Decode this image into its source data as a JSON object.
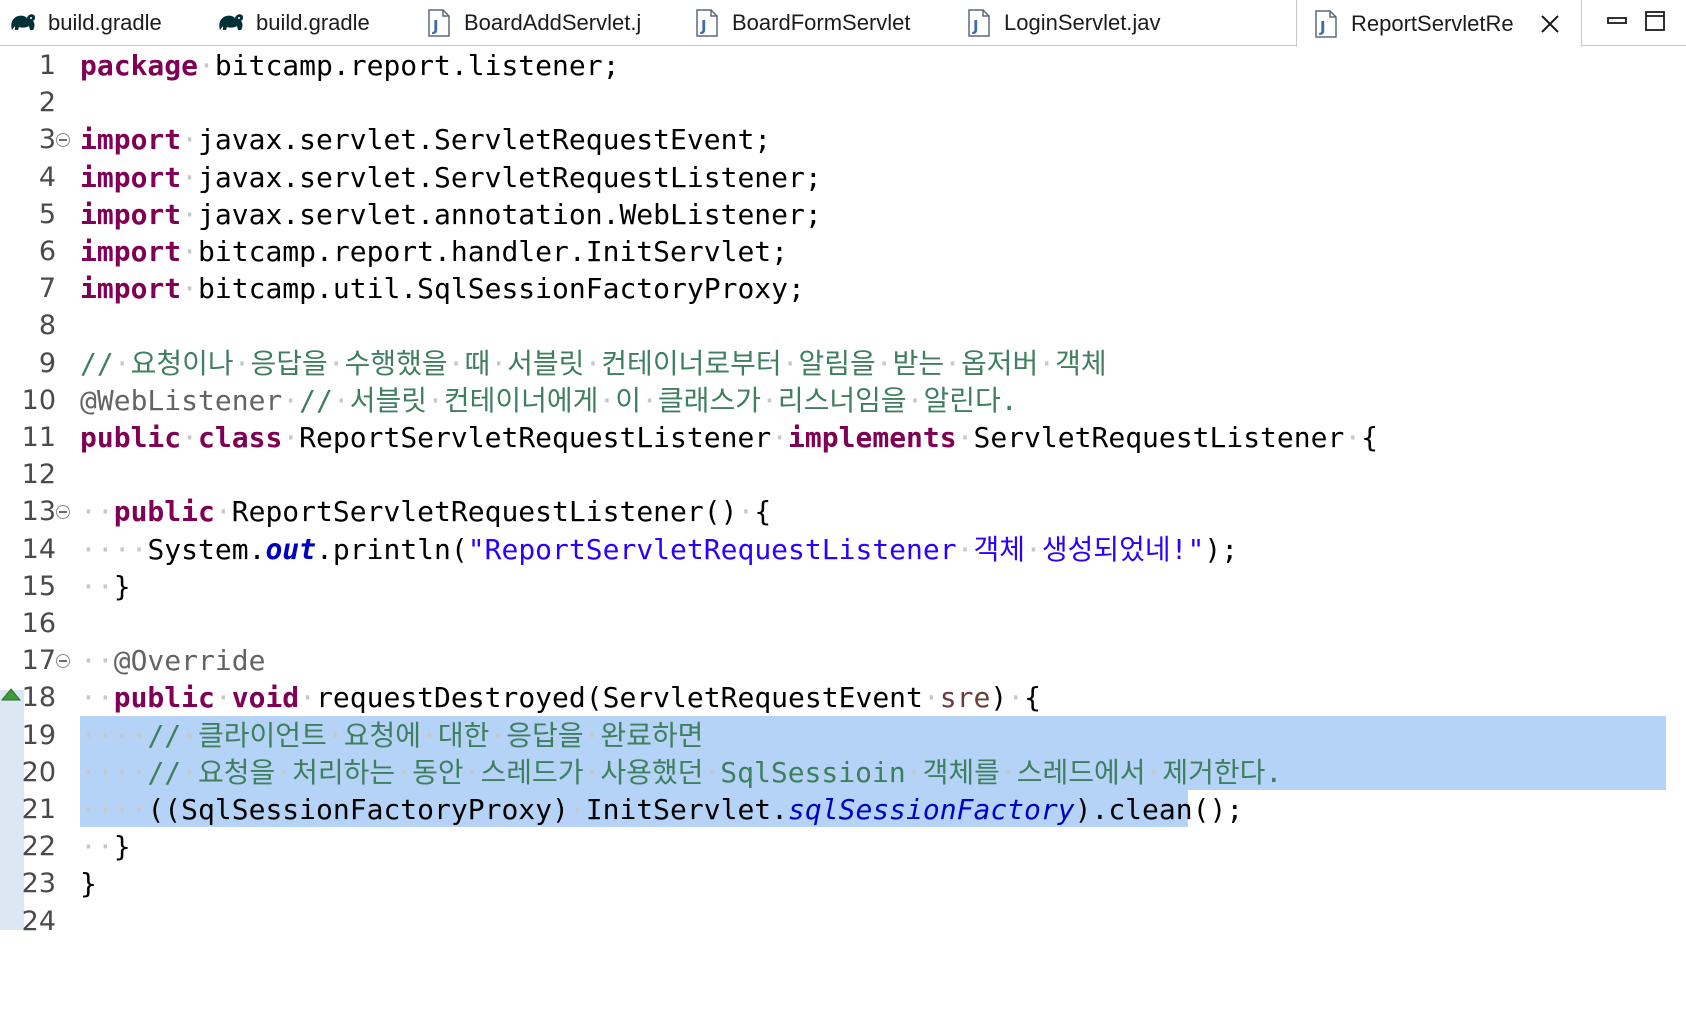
{
  "tabs": [
    {
      "label": "build.gradle",
      "icon": "gradle-elephant-icon"
    },
    {
      "label": "build.gradle",
      "icon": "gradle-elephant-icon"
    },
    {
      "label": "BoardAddServlet.j",
      "icon": "java-file-icon"
    },
    {
      "label": "BoardFormServlet",
      "icon": "java-file-icon"
    },
    {
      "label": "LoginServlet.jav",
      "icon": "java-file-icon"
    },
    {
      "label": "ReportServletRe",
      "icon": "java-file-icon",
      "active": true
    }
  ],
  "window_controls": {
    "minimize": "minimize-icon",
    "maximize": "maximize-icon"
  },
  "editor": {
    "colors": {
      "keyword": "#7f0055",
      "comment": "#3f7f5f",
      "annotation": "#646464",
      "string": "#2a00ff",
      "static_field": "#0000c0",
      "parameter": "#6a3e3e",
      "selection": "#b5d3f6",
      "whitespace_marker": "#c8c8c8"
    },
    "lines": [
      {
        "n": "1",
        "code": "package·bitcamp.report.listener;"
      },
      {
        "n": "2",
        "code": ""
      },
      {
        "n": "3",
        "code": "import·javax.servlet.ServletRequestEvent;",
        "fold": true
      },
      {
        "n": "4",
        "code": "import·javax.servlet.ServletRequestListener;"
      },
      {
        "n": "5",
        "code": "import·javax.servlet.annotation.WebListener;"
      },
      {
        "n": "6",
        "code": "import·bitcamp.report.handler.InitServlet;"
      },
      {
        "n": "7",
        "code": "import·bitcamp.util.SqlSessionFactoryProxy;"
      },
      {
        "n": "8",
        "code": ""
      },
      {
        "n": "9",
        "code": "//·요청이나·응답을·수행했을·때·서블릿·컨테이너로부터·알림을·받는·옵저버·객체"
      },
      {
        "n": "10",
        "code": "@WebListener·//·서블릿·컨테이너에게·이·클래스가·리스너임을·알린다."
      },
      {
        "n": "11",
        "code": "public·class·ReportServletRequestListener·implements·ServletRequestListener·{"
      },
      {
        "n": "12",
        "code": ""
      },
      {
        "n": "13",
        "code": "··public·ReportServletRequestListener()·{",
        "fold": true
      },
      {
        "n": "14",
        "code": "····System.out.println(\"ReportServletRequestListener·객체·생성되었네!\");"
      },
      {
        "n": "15",
        "code": "··}"
      },
      {
        "n": "16",
        "code": ""
      },
      {
        "n": "17",
        "code": "··@Override",
        "fold": true
      },
      {
        "n": "18",
        "code": "··public·void·requestDestroyed(ServletRequestEvent·sre)·{",
        "override_marker": true
      },
      {
        "n": "19",
        "code": "····//·클라이언트·요청에·대한·응답을·완료하면"
      },
      {
        "n": "20",
        "code": "····//·요청을·처리하는·동안·스레드가·사용했던·SqlSessioin·객체를·스레드에서·제거한다."
      },
      {
        "n": "21",
        "code": "····((SqlSessionFactoryProxy)·InitServlet.sqlSessionFactory).clean();"
      },
      {
        "n": "22",
        "code": "··}"
      },
      {
        "n": "23",
        "code": "}"
      },
      {
        "n": "24",
        "code": ""
      }
    ],
    "selected_lines": [
      "19",
      "20",
      "21"
    ]
  }
}
